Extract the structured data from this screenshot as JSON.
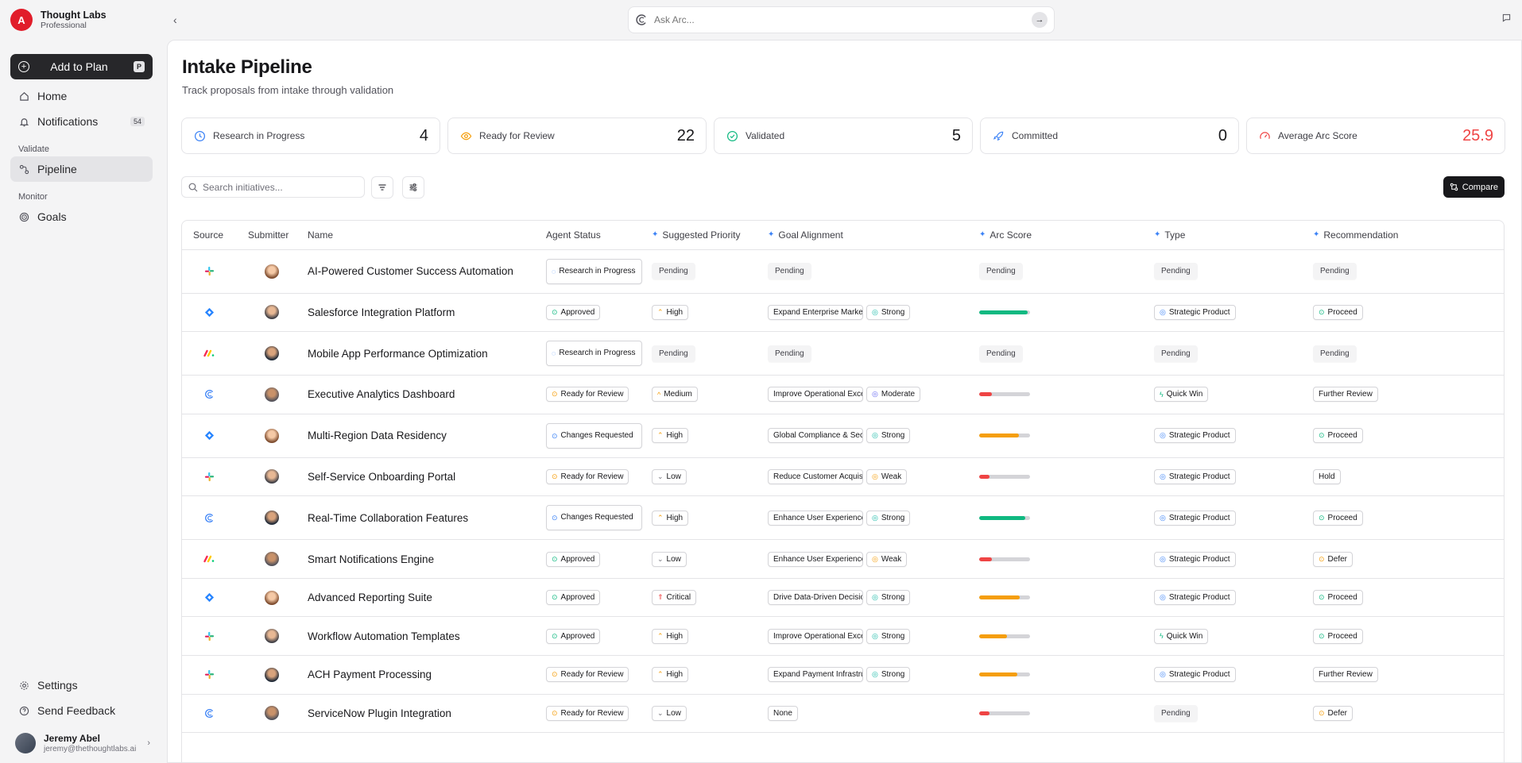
{
  "brand": {
    "name": "Thought Labs",
    "plan": "Professional",
    "logo_letter": "A"
  },
  "sidebar": {
    "add_button": {
      "label": "Add to Plan",
      "shortcut": "P"
    },
    "items": [
      {
        "label": "Home"
      },
      {
        "label": "Notifications",
        "badge": "54"
      }
    ],
    "sections": [
      {
        "title": "Validate",
        "items": [
          {
            "label": "Pipeline",
            "active": true
          }
        ]
      },
      {
        "title": "Monitor",
        "items": [
          {
            "label": "Goals"
          }
        ]
      }
    ],
    "bottom": [
      {
        "label": "Settings"
      },
      {
        "label": "Send Feedback"
      }
    ],
    "user": {
      "name": "Jeremy Abel",
      "email": "jeremy@thethoughtlabs.ai"
    }
  },
  "ask": {
    "placeholder": "Ask Arc..."
  },
  "page": {
    "title": "Intake Pipeline",
    "subtitle": "Track proposals from intake through validation"
  },
  "stats": [
    {
      "label": "Research in Progress",
      "value": "4",
      "icon": "clock-icon",
      "color": "#3b82f6"
    },
    {
      "label": "Ready for Review",
      "value": "22",
      "icon": "eye-icon",
      "color": "#f59e0b"
    },
    {
      "label": "Validated",
      "value": "5",
      "icon": "check-circle-icon",
      "color": "#10b981"
    },
    {
      "label": "Committed",
      "value": "0",
      "icon": "rocket-icon",
      "color": "#3b82f6"
    },
    {
      "label": "Average Arc Score",
      "value": "25.9",
      "icon": "gauge-icon",
      "color": "#ef4444"
    }
  ],
  "toolbar": {
    "search_placeholder": "Search initiatives...",
    "compare_label": "Compare"
  },
  "table": {
    "columns": [
      "Source",
      "Submitter",
      "Name",
      "Agent Status",
      "Suggested Priority",
      "Goal Alignment",
      "Arc Score",
      "Type",
      "Recommendation"
    ],
    "rows": [
      {
        "source": "slack",
        "name": "AI-Powered Customer Success Automation",
        "status": "Research in Progress",
        "priority": "Pending",
        "goal": "Pending",
        "strength": "",
        "score": null,
        "type": "Pending",
        "rec": "Pending"
      },
      {
        "source": "jira",
        "name": "Salesforce Integration Platform",
        "status": "Approved",
        "priority": "High",
        "goal": "Expand Enterprise Market",
        "strength": "Strong",
        "score": 0.95,
        "type": "Strategic Product",
        "rec": "Proceed"
      },
      {
        "source": "monday",
        "name": "Mobile App Performance Optimization",
        "status": "Research in Progress",
        "priority": "Pending",
        "goal": "Pending",
        "strength": "",
        "score": null,
        "type": "Pending",
        "rec": "Pending"
      },
      {
        "source": "arc",
        "name": "Executive Analytics Dashboard",
        "status": "Ready for Review",
        "priority": "Medium",
        "goal": "Improve Operational Excellence",
        "strength": "Moderate",
        "score": 0.25,
        "type": "Quick Win",
        "rec": "Further Review"
      },
      {
        "source": "jira",
        "name": "Multi-Region Data Residency",
        "status": "Changes Requested",
        "priority": "High",
        "goal": "Global Compliance & Security",
        "strength": "Strong",
        "score": 0.78,
        "type": "Strategic Product",
        "rec": "Proceed"
      },
      {
        "source": "slack",
        "name": "Self-Service Onboarding Portal",
        "status": "Ready for Review",
        "priority": "Low",
        "goal": "Reduce Customer Acquisition",
        "strength": "Weak",
        "score": 0.2,
        "type": "Strategic Product",
        "rec": "Hold"
      },
      {
        "source": "arc",
        "name": "Real-Time Collaboration Features",
        "status": "Changes Requested",
        "priority": "High",
        "goal": "Enhance User Experience",
        "strength": "Strong",
        "score": 0.9,
        "type": "Strategic Product",
        "rec": "Proceed"
      },
      {
        "source": "monday",
        "name": "Smart Notifications Engine",
        "status": "Approved",
        "priority": "Low",
        "goal": "Enhance User Experience",
        "strength": "Weak",
        "score": 0.25,
        "type": "Strategic Product",
        "rec": "Defer"
      },
      {
        "source": "jira",
        "name": "Advanced Reporting Suite",
        "status": "Approved",
        "priority": "Critical",
        "goal": "Drive Data-Driven Decisions",
        "strength": "Strong",
        "score": 0.8,
        "type": "Strategic Product",
        "rec": "Proceed"
      },
      {
        "source": "slack",
        "name": "Workflow Automation Templates",
        "status": "Approved",
        "priority": "High",
        "goal": "Improve Operational Excellence",
        "strength": "Strong",
        "score": 0.55,
        "type": "Quick Win",
        "rec": "Proceed"
      },
      {
        "source": "slack",
        "name": "ACH Payment Processing",
        "status": "Ready for Review",
        "priority": "High",
        "goal": "Expand Payment Infrastructure",
        "strength": "Strong",
        "score": 0.75,
        "type": "Strategic Product",
        "rec": "Further Review"
      },
      {
        "source": "arc",
        "name": "ServiceNow Plugin Integration",
        "status": "Ready for Review",
        "priority": "Low",
        "goal": "None",
        "strength": "",
        "score": 0.2,
        "type": "Pending",
        "rec": "Defer"
      }
    ]
  },
  "colors": {
    "accent": "#18181b",
    "brand_red": "#e11d2a",
    "score_green": "#10b981",
    "score_orange": "#f59e0b",
    "score_red": "#ef4444"
  }
}
